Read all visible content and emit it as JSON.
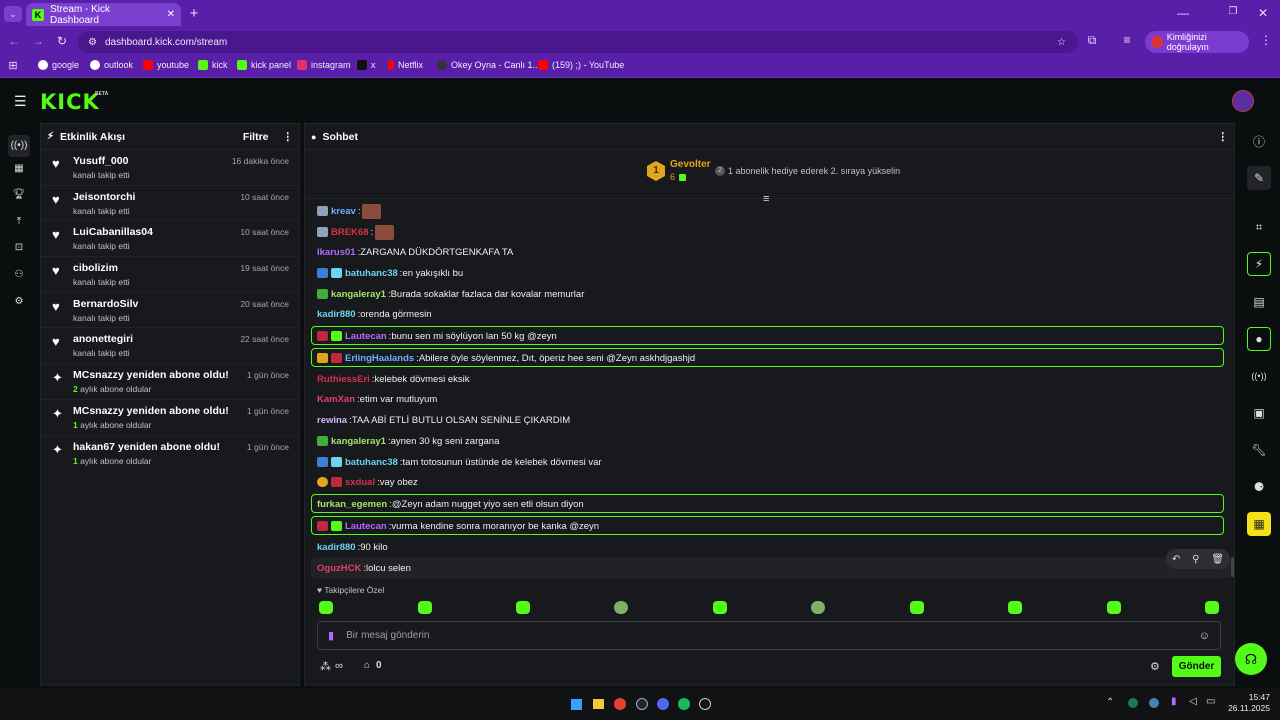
{
  "browser": {
    "tab_title": "Stream - Kick Dashboard",
    "url": "dashboard.kick.com/stream",
    "verify_label": "Kimliğinizi doğrulayın",
    "bookmarks": [
      {
        "label": "google",
        "color": "#ffffff"
      },
      {
        "label": "outlook",
        "color": "#ffffff"
      },
      {
        "label": "youtube",
        "color": "#ff0000"
      },
      {
        "label": "kick",
        "color": "#53fc18"
      },
      {
        "label": "kick panel",
        "color": "#53fc18"
      },
      {
        "label": "instagram",
        "color": "#e1306c"
      },
      {
        "label": "x",
        "color": "#000000"
      },
      {
        "label": "Netflix",
        "color": "#e50914"
      },
      {
        "label": "Okey Oyna - Canlı 1...",
        "color": "#333333"
      },
      {
        "label": "(159) ;) - YouTube",
        "color": "#ff0000"
      }
    ]
  },
  "kick": {
    "logo": "KICK",
    "beta": "BETA"
  },
  "events": {
    "title": "Etkinlik Akışı",
    "filter_label": "Filtre",
    "items": [
      {
        "icon": "heart-icon",
        "name": "Yusuff_000",
        "desc": "kanalı takip etti",
        "time": "16 dakika önce"
      },
      {
        "icon": "heart-icon",
        "name": "Jeisontorchi",
        "desc": "kanalı takip etti",
        "time": "10 saat önce"
      },
      {
        "icon": "heart-icon",
        "name": "LuiCabanillas04",
        "desc": "kanalı takip etti",
        "time": "10 saat önce"
      },
      {
        "icon": "heart-icon",
        "name": "cibolizim",
        "desc": "kanalı takip etti",
        "time": "19 saat önce"
      },
      {
        "icon": "heart-icon",
        "name": "BernardoSilv",
        "desc": "kanalı takip etti",
        "time": "20 saat önce"
      },
      {
        "icon": "heart-icon",
        "name": "anonettegiri",
        "desc": "kanalı takip etti",
        "time": "22 saat önce"
      },
      {
        "icon": "sparkle-icon",
        "name": "MCsnazzy yeniden abone oldu!",
        "count": "2",
        "desc": "aylık abone oldular",
        "time": "1 gün önce"
      },
      {
        "icon": "sparkle-icon",
        "name": "MCsnazzy yeniden abone oldu!",
        "count": "1",
        "desc": "aylık abone oldular",
        "time": "1 gün önce"
      },
      {
        "icon": "sparkle-icon",
        "name": "hakan67 yeniden abone oldu!",
        "count": "1",
        "desc": "aylık abone oldular",
        "time": "1 gün önce"
      }
    ]
  },
  "chat": {
    "title": "Sohbet",
    "leader": {
      "rank": "1",
      "name": "Gevolter",
      "count": "6"
    },
    "gift_text": "1 abonelik hediye ederek 2. sıraya yükselin",
    "messages": [
      {
        "user": "kreav",
        "color": "#6ab0ff",
        "text": "",
        "emote": true
      },
      {
        "user": "BREK68",
        "color": "#d9304a",
        "text": "",
        "emote": true
      },
      {
        "user": "Ikarus01",
        "color": "#b36bff",
        "text": "ZARGANA DÜKDÖRTGENKAFA TA"
      },
      {
        "user": "batuhanc38",
        "color": "#6ad3f0",
        "text": "en yakışıklı bu"
      },
      {
        "user": "kangaleray1",
        "color": "#a7e26a",
        "text": "Burada sokaklar fazlaca dar kovalar memurlar"
      },
      {
        "user": "kadir880",
        "color": "#6ad3f0",
        "text": "orenda görmesin"
      },
      {
        "user": "Lautecan",
        "color": "#b36bff",
        "text": "bunu sen mi söylüyon lan 50 kg @zeyn",
        "highlight": true
      },
      {
        "user": "ErlingHaalands",
        "color": "#6ab0ff",
        "text": "Abilere öyle söylenmez, Dıt, öperiz hee seni @Zeyn askhdjgashjd",
        "highlight": true
      },
      {
        "user": "RuthiessEri",
        "color": "#d9304a",
        "text": "kelebek dövmesi eksik"
      },
      {
        "user": "KamXan",
        "color": "#e0406a",
        "text": "etim var mutluyum"
      },
      {
        "user": "rewina",
        "color": "#d7b3ff",
        "text": "TAA ABİ ETLİ BUTLU OLSAN SENİNLE ÇIKARDIM"
      },
      {
        "user": "kangaleray1",
        "color": "#a7e26a",
        "text": "aynen 30 kg seni zargana"
      },
      {
        "user": "batuhanc38",
        "color": "#6ad3f0",
        "text": "tam totosunun üstünde de kelebek dövmesi var"
      },
      {
        "user": "sxdual",
        "color": "#d9304a",
        "text": "vay obez"
      },
      {
        "user": "furkan_egemen",
        "color": "#a7e26a",
        "text": "@Zeyn adam nugget yiyo sen etli olsun diyon",
        "highlight": true
      },
      {
        "user": "Lautecan",
        "color": "#b36bff",
        "text": "vurma kendine sonra moranıyor be kanka @zeyn",
        "highlight": true
      },
      {
        "user": "kadir880",
        "color": "#6ad3f0",
        "text": "90 kilo"
      },
      {
        "user": "OguzHCK",
        "color": "#e0406a",
        "text": "lolcu selen"
      }
    ],
    "followers_only_label": "Takipçilere Özel",
    "input_placeholder": "Bir mesaj gönderin",
    "points_label": "∞",
    "shop_count": "0",
    "send_label": "Gönder"
  },
  "taskbar": {
    "time": "15:47",
    "date": "26.11.2025"
  },
  "colors": {
    "accent": "#53fc18",
    "browser": "#5a1fa8",
    "panel": "#18191c"
  }
}
